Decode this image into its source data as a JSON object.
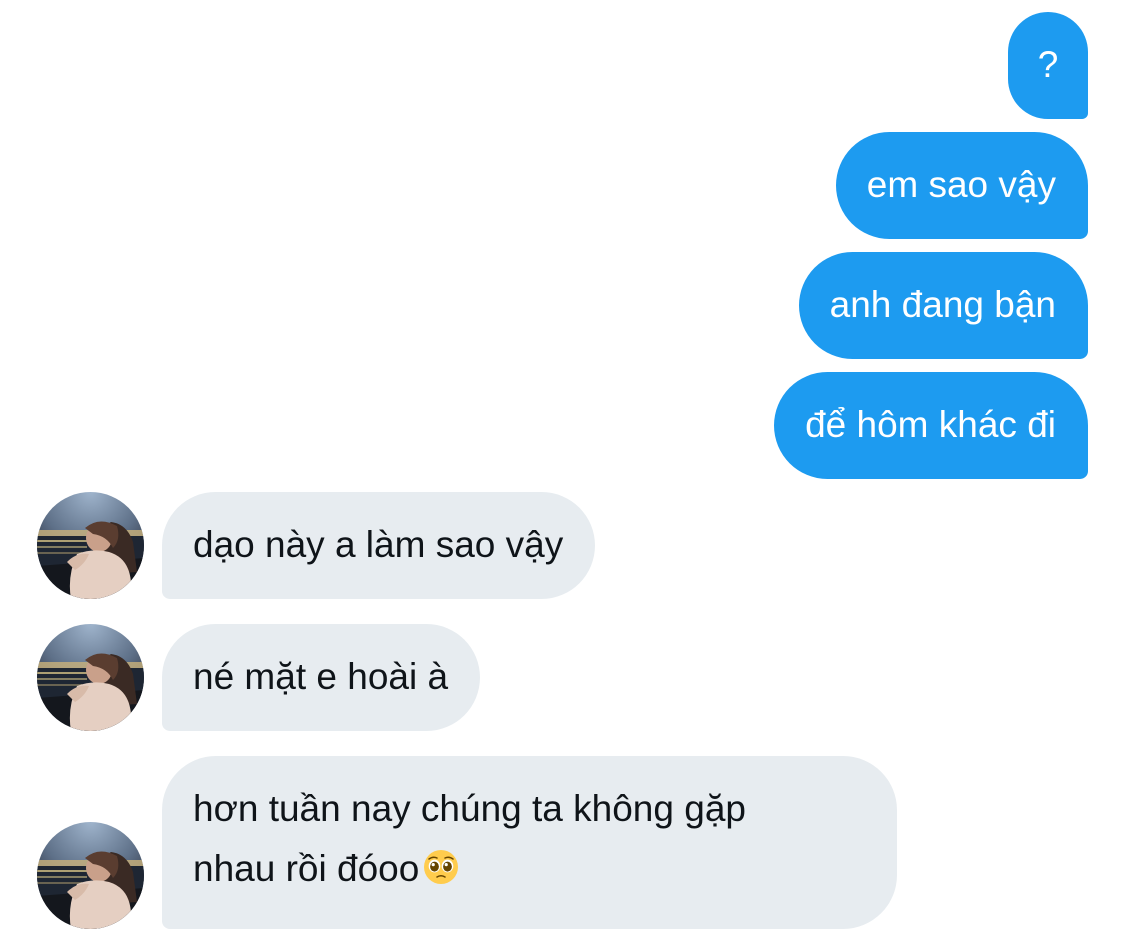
{
  "conversation": {
    "sent": [
      {
        "text": "?"
      },
      {
        "text": "em sao vậy"
      },
      {
        "text": "anh đang bận"
      },
      {
        "text": "để hôm khác đi"
      }
    ],
    "received": [
      {
        "text": "dạo này a làm sao vậy"
      },
      {
        "text": "né mặt e hoài à"
      },
      {
        "line1": "hơn tuần nay chúng ta không gặp",
        "line2": "nhau rồi đóoo",
        "emoji": "pleading-face-icon"
      }
    ],
    "colors": {
      "sent_bubble": "#1d9bf0",
      "received_bubble": "#e7ecf0",
      "received_text": "#0f1419",
      "sent_text": "#ffffff"
    },
    "avatar_icon": "user-avatar-photo"
  }
}
